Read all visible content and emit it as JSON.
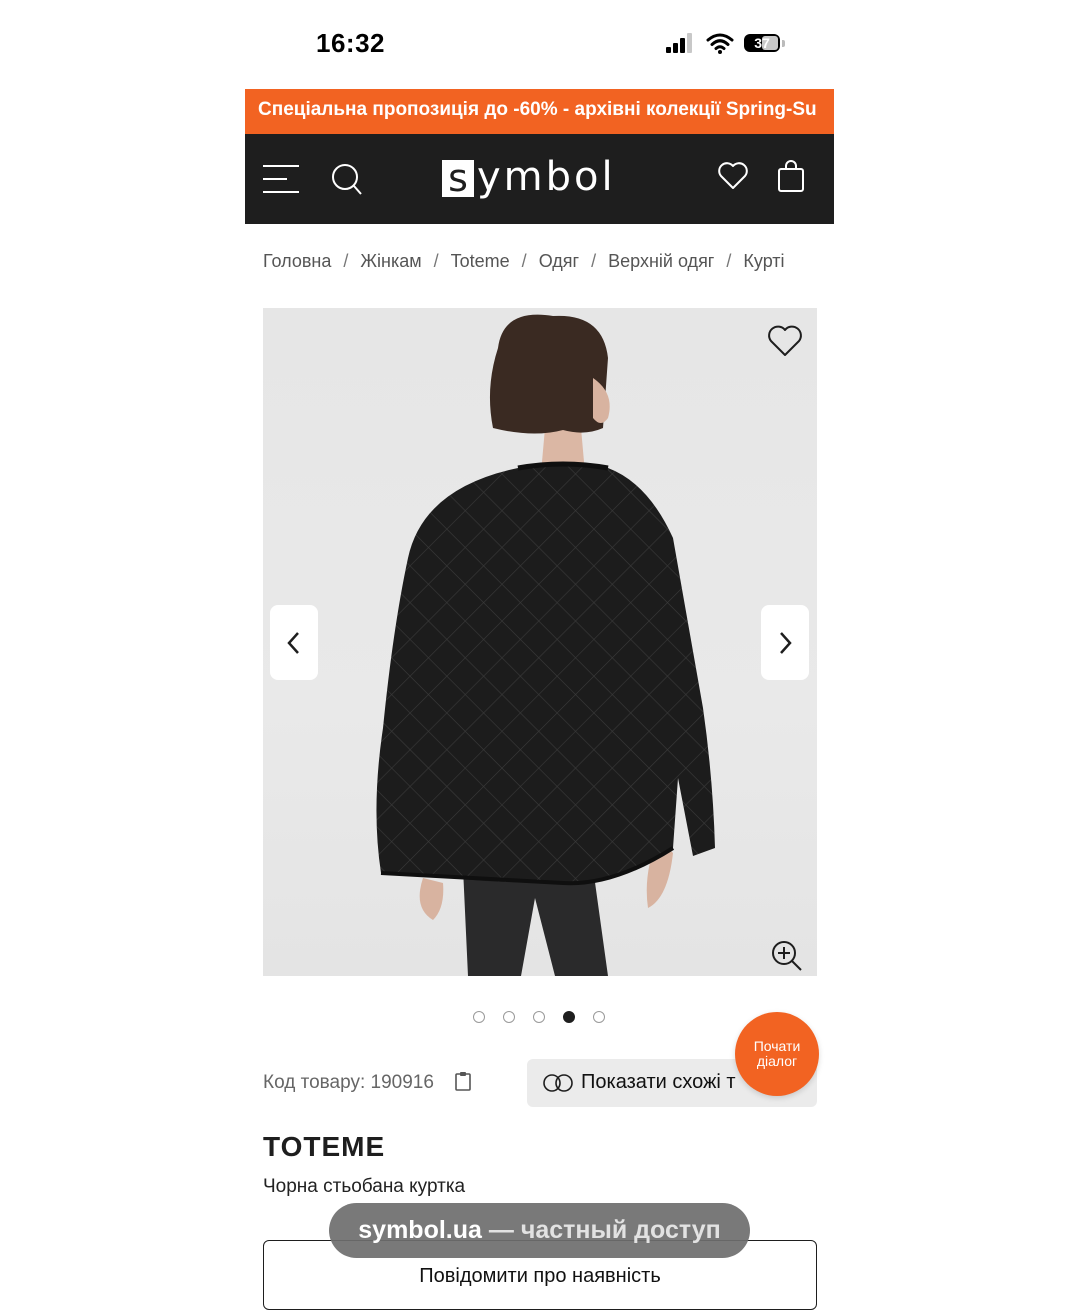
{
  "status_bar": {
    "time": "16:32",
    "battery": "37"
  },
  "promo": {
    "text": "Спеціальна пропозиція до -60% - архівні колекції Spring-Su"
  },
  "header": {
    "logo_letter": "s",
    "logo_rest": "ymbol"
  },
  "breadcrumb": [
    "Головна",
    "Жінкам",
    "Toteme",
    "Одяг",
    "Верхній одяг",
    "Курті"
  ],
  "gallery": {
    "slides_total": 5,
    "active_slide": 4
  },
  "product": {
    "code_label": "Код товару: 190916",
    "similar_label": "Показати схожі т",
    "brand": "TOTEME",
    "name": "Чорна стьобана куртка",
    "notify_label": "Повідомити про наявність"
  },
  "chat": {
    "label": "Почати діалог"
  },
  "overlay": {
    "domain": "symbol.ua",
    "suffix": " — частный доступ"
  },
  "colors": {
    "accent": "#f26322",
    "header_bg": "#1e1e1e"
  }
}
